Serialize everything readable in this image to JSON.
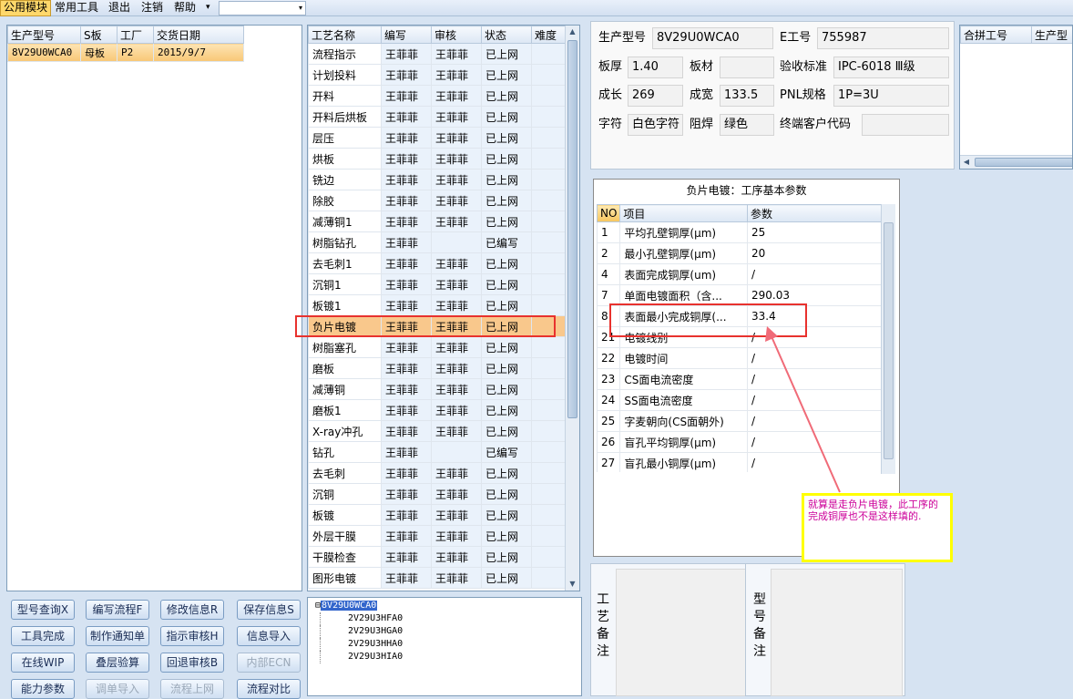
{
  "menubar": {
    "items": [
      "公用模块",
      "常用工具",
      "退出",
      "注销",
      "帮助"
    ],
    "dropdown_arrow": "▾",
    "combo_arrow": "▾"
  },
  "model_list": {
    "headers": [
      "生产型号",
      "S板",
      "工厂",
      "交货日期"
    ],
    "rows": [
      [
        "8V29U0WCA0",
        "母板",
        "P2",
        "2015/9/7"
      ]
    ]
  },
  "process_list": {
    "headers": [
      "工艺名称",
      "编写",
      "审核",
      "状态",
      "难度"
    ],
    "rows": [
      [
        "流程指示",
        "王菲菲",
        "王菲菲",
        "已上网",
        ""
      ],
      [
        "计划投料",
        "王菲菲",
        "王菲菲",
        "已上网",
        ""
      ],
      [
        "开料",
        "王菲菲",
        "王菲菲",
        "已上网",
        ""
      ],
      [
        "开料后烘板",
        "王菲菲",
        "王菲菲",
        "已上网",
        ""
      ],
      [
        "层压",
        "王菲菲",
        "王菲菲",
        "已上网",
        ""
      ],
      [
        "烘板",
        "王菲菲",
        "王菲菲",
        "已上网",
        ""
      ],
      [
        "铣边",
        "王菲菲",
        "王菲菲",
        "已上网",
        ""
      ],
      [
        "除胶",
        "王菲菲",
        "王菲菲",
        "已上网",
        ""
      ],
      [
        "减薄铜1",
        "王菲菲",
        "王菲菲",
        "已上网",
        ""
      ],
      [
        "树脂钻孔",
        "王菲菲",
        "",
        "已编写",
        ""
      ],
      [
        "去毛刺1",
        "王菲菲",
        "王菲菲",
        "已上网",
        ""
      ],
      [
        "沉铜1",
        "王菲菲",
        "王菲菲",
        "已上网",
        ""
      ],
      [
        "板镀1",
        "王菲菲",
        "王菲菲",
        "已上网",
        ""
      ],
      [
        "负片电镀",
        "王菲菲",
        "王菲菲",
        "已上网",
        ""
      ],
      [
        "树脂塞孔",
        "王菲菲",
        "王菲菲",
        "已上网",
        ""
      ],
      [
        "磨板",
        "王菲菲",
        "王菲菲",
        "已上网",
        ""
      ],
      [
        "减薄铜",
        "王菲菲",
        "王菲菲",
        "已上网",
        ""
      ],
      [
        "磨板1",
        "王菲菲",
        "王菲菲",
        "已上网",
        ""
      ],
      [
        "X-ray冲孔",
        "王菲菲",
        "王菲菲",
        "已上网",
        ""
      ],
      [
        "钻孔",
        "王菲菲",
        "",
        "已编写",
        ""
      ],
      [
        "去毛刺",
        "王菲菲",
        "王菲菲",
        "已上网",
        ""
      ],
      [
        "沉铜",
        "王菲菲",
        "王菲菲",
        "已上网",
        ""
      ],
      [
        "板镀",
        "王菲菲",
        "王菲菲",
        "已上网",
        ""
      ],
      [
        "外层干膜",
        "王菲菲",
        "王菲菲",
        "已上网",
        ""
      ],
      [
        "干膜检查",
        "王菲菲",
        "王菲菲",
        "已上网",
        ""
      ],
      [
        "图形电镀",
        "王菲菲",
        "王菲菲",
        "已上网",
        ""
      ]
    ],
    "selected_index": 13
  },
  "buttons": [
    {
      "label": "型号查询X",
      "enabled": true
    },
    {
      "label": "编写流程F",
      "enabled": true
    },
    {
      "label": "修改信息R",
      "enabled": true
    },
    {
      "label": "保存信息S",
      "enabled": true
    },
    {
      "label": "工具完成",
      "enabled": true
    },
    {
      "label": "制作通知单",
      "enabled": true
    },
    {
      "label": "指示审核H",
      "enabled": true
    },
    {
      "label": "信息导入",
      "enabled": true
    },
    {
      "label": "在线WIP",
      "enabled": true
    },
    {
      "label": "叠层验算",
      "enabled": true
    },
    {
      "label": "回退审核B",
      "enabled": true
    },
    {
      "label": "内部ECN",
      "enabled": false
    },
    {
      "label": "能力参数",
      "enabled": true
    },
    {
      "label": "调单导入",
      "enabled": false
    },
    {
      "label": "流程上网",
      "enabled": false
    },
    {
      "label": "流程对比",
      "enabled": true
    }
  ],
  "tree": {
    "root": "8V29U0WCA0",
    "children": [
      "2V29U3HFA0",
      "2V29U3HGA0",
      "2V29U3HHA0",
      "2V29U3HIA0"
    ],
    "expander": "⊟"
  },
  "info": {
    "model_label": "生产型号",
    "model_value": "8V29U0WCA0",
    "eno_label": "E工号",
    "eno_value": "755987",
    "thickness_label": "板厚",
    "thickness_value": "1.40",
    "material_label": "板材",
    "material_value": "",
    "standard_label": "验收标准",
    "standard_value": "IPC-6018 Ⅲ级",
    "length_label": "成长",
    "length_value": "269",
    "width_label": "成宽",
    "width_value": "133.5",
    "pnl_label": "PNL规格",
    "pnl_value": "1P=3U",
    "char_label": "字符",
    "char_value": "白色字符",
    "mask_label": "阻焊",
    "mask_value": "绿色",
    "cust_label": "终端客户代码",
    "cust_value": ""
  },
  "merge": {
    "headers": [
      "合拼工号",
      "生产型"
    ]
  },
  "params": {
    "title": "负片电镀：工序基本参数",
    "headers": [
      "NO",
      "项目",
      "参数"
    ],
    "rows": [
      [
        "1",
        "平均孔壁铜厚(μm)",
        "25"
      ],
      [
        "2",
        "最小孔壁铜厚(μm)",
        "20"
      ],
      [
        "4",
        "表面完成铜厚(um)",
        "/"
      ],
      [
        "7",
        "单面电镀面积（含...",
        "290.03"
      ],
      [
        "8",
        "表面最小完成铜厚(...",
        "33.4"
      ],
      [
        "21",
        "电镀线别",
        "/"
      ],
      [
        "22",
        "电镀时间",
        "/"
      ],
      [
        "23",
        "CS面电流密度",
        "/"
      ],
      [
        "24",
        "SS面电流密度",
        "/"
      ],
      [
        "25",
        "字麦朝向(CS面朝外)",
        "/"
      ],
      [
        "26",
        "盲孔平均铜厚(μm)",
        "/"
      ],
      [
        "27",
        "盲孔最小铜厚(μm)",
        "/"
      ]
    ]
  },
  "remarks": {
    "process_label": "工艺备注",
    "model_label": "型号备注"
  },
  "annotation": {
    "text": "就算是走负片电镀，此工序的完成铜厚也不是这样填的.",
    "color": "#cc0099",
    "border": "#ffff00",
    "box_color": "#e8322e",
    "arrow_color": "#f06b78"
  }
}
